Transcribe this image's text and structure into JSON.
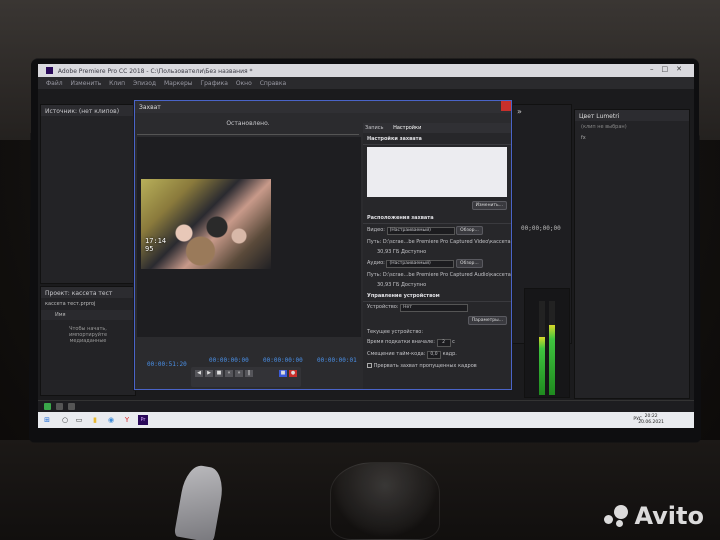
{
  "app": {
    "title": "Adobe Premiere Pro CC 2018 - C:\\Пользователи\\Без названия *"
  },
  "menu": [
    "Файл",
    "Изменить",
    "Клип",
    "Эпизод",
    "Маркеры",
    "Графика",
    "Окно",
    "Справка"
  ],
  "source_panel": {
    "tab": "Источник: (нет клипов)"
  },
  "project_panel": {
    "tab": "Проект: кассета тест",
    "file": "кассета тест.prproj",
    "column": "Имя",
    "hint": "Чтобы начать, импортируйте медиаданные"
  },
  "capture": {
    "title": "Захват",
    "status": "Остановлено.",
    "video_stamp": "17:14\n95",
    "timecode_left": "00:00:51:20",
    "timecode_in": "00:00:00:00",
    "timecode_out": "00:00:00:00",
    "timecode_dur": "00:00:00:01"
  },
  "settings": {
    "tabs": [
      "Запись",
      "Настройки"
    ],
    "capture_settings": {
      "title": "Настройки захвата",
      "change_button": "Изменить..."
    },
    "locations": {
      "title": "Расположения захвата",
      "video_label": "Видео:",
      "video_value": "(Настраиваемый)",
      "video_button": "Обзор...",
      "video_path": "Путь: D:\\scrae...be Premiere Pro Captured Video\\кассета тест",
      "video_free": "30,93 ГБ Доступно",
      "audio_label": "Аудио:",
      "audio_value": "(Настраиваемый)",
      "audio_button": "Обзор...",
      "audio_path": "Путь: D:\\scrae...be Premiere Pro Captured Audio\\кассета тест",
      "audio_free": "30,93 ГБ Доступно"
    },
    "device_control": {
      "title": "Управление устройством",
      "device_label": "Устройство:",
      "device_value": "Нет",
      "params_button": "Параметры...",
      "current_device": "Текущее устройство:",
      "preroll_label": "Время подкатки вначале:",
      "preroll_value": "2",
      "preroll_unit": "с",
      "offset_label": "Смещение тайм-кода:",
      "offset_value": "0,0",
      "offset_unit": "кадр.",
      "abort_label": "Прервать захват пропущенных кадров"
    }
  },
  "program_panel": {
    "timecode": "00;00;00;00"
  },
  "lumetri": {
    "title": "Цвет Lumetri",
    "subtitle": "(клип не выбран)"
  },
  "audio_meter": {
    "left_level": 0.62,
    "right_level": 0.74
  },
  "taskbar": {
    "lang": "РУС",
    "time": "20:22",
    "date": "20.06.2021"
  },
  "watermark": "Avito",
  "colors": {
    "accent": "#4a90e8",
    "record": "#3b5bd8",
    "close": "#c8302c"
  }
}
